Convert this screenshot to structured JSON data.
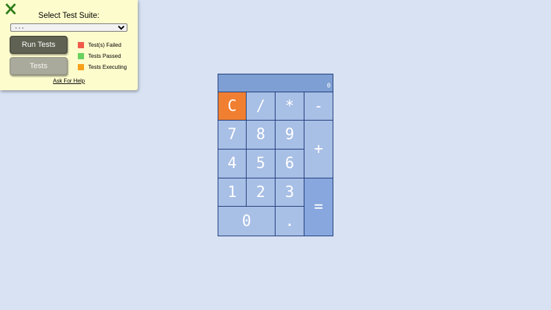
{
  "test_panel": {
    "title": "Select Test Suite:",
    "suite_select": {
      "selected": "- - -",
      "options": [
        "- - -"
      ]
    },
    "run_button": "Run Tests",
    "tests_button": "Tests",
    "legend": [
      {
        "label": "Test(s) Failed",
        "color": "#f15b4a"
      },
      {
        "label": "Tests Passed",
        "color": "#69d15f"
      },
      {
        "label": "Tests Executing",
        "color": "#f7a11b"
      }
    ],
    "help_link": "Ask For Help",
    "close_icon": "close-x-icon",
    "close_color": "#2e7d1b"
  },
  "calculator": {
    "display": "0",
    "keys": {
      "clear": "C",
      "divide": "/",
      "multiply": "*",
      "subtract": "-",
      "seven": "7",
      "eight": "8",
      "nine": "9",
      "add": "+",
      "four": "4",
      "five": "5",
      "six": "6",
      "one": "1",
      "two": "2",
      "three": "3",
      "equals": "=",
      "zero": "0",
      "decimal": "."
    },
    "colors": {
      "key": "#a8bfe6",
      "clear": "#f07f31",
      "equals": "#87a7de",
      "display": "#7e9fd3",
      "border": "#1f3a78"
    }
  }
}
